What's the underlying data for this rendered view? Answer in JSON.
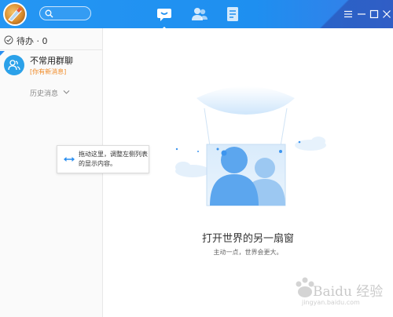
{
  "topbar": {
    "tabs": [
      {
        "name": "messages",
        "icon": "chat-bubble-icon",
        "active": true
      },
      {
        "name": "contacts",
        "icon": "contacts-icon",
        "active": false
      },
      {
        "name": "apps",
        "icon": "document-icon",
        "active": false
      }
    ],
    "window_controls": [
      "menu-icon",
      "minimize-icon",
      "maximize-icon",
      "close-icon"
    ]
  },
  "sidebar": {
    "todo_label": "待办 · 0",
    "conversations": [
      {
        "name": "不常用群聊",
        "preview": "[你有新消息]",
        "icon": "group-icon"
      }
    ],
    "history_label": "历史消息"
  },
  "tooltip": {
    "text": "拖动这里，调整左侧列表的显示内容。"
  },
  "main": {
    "title": "打开世界的另一扇窗",
    "subtitle": "主动一点，世界会更大。"
  },
  "watermark": {
    "line1": "Baidu 经验",
    "line2": "jingyan.baidu.com"
  },
  "colors": {
    "topbar": "#1e8ff0",
    "accent": "#2ba1e9",
    "preview": "#f08a26"
  }
}
